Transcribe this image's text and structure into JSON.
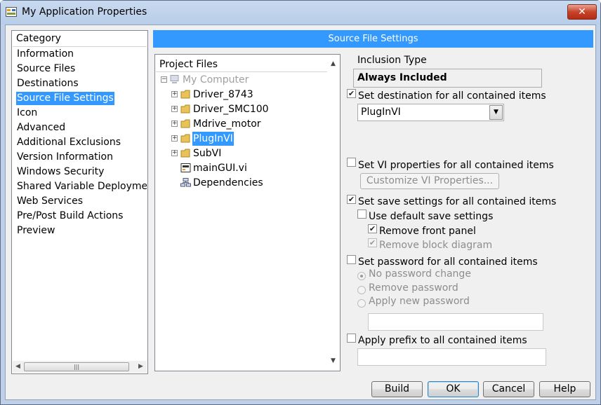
{
  "window": {
    "title": "My Application Properties",
    "close_label": "✕"
  },
  "category": {
    "header": "Category",
    "items": [
      "Information",
      "Source Files",
      "Destinations",
      "Source File Settings",
      "Icon",
      "Advanced",
      "Additional Exclusions",
      "Version Information",
      "Windows Security",
      "Shared Variable Deploymen",
      "Web Services",
      "Pre/Post Build Actions",
      "Preview"
    ],
    "selected": "Source File Settings"
  },
  "section_title": "Source File Settings",
  "project_files": {
    "header": "Project Files",
    "root": "My Computer",
    "items": [
      {
        "label": "Driver_8743",
        "icon": "folder-icon"
      },
      {
        "label": "Driver_SMC100",
        "icon": "folder-icon"
      },
      {
        "label": "Mdrive_motor",
        "icon": "folder-icon"
      },
      {
        "label": "PlugInVI",
        "icon": "folder-icon"
      },
      {
        "label": "SubVI",
        "icon": "folder-icon"
      },
      {
        "label": "mainGUI.vi",
        "icon": "vi-file-icon"
      },
      {
        "label": "Dependencies",
        "icon": "dependencies-icon"
      }
    ],
    "selected": "PlugInVI"
  },
  "settings": {
    "inclusion_type_label": "Inclusion Type",
    "inclusion_type_value": "Always Included",
    "set_destination_label": "Set destination for all contained items",
    "set_destination_checked": true,
    "destination_value": "PlugInVI",
    "set_vi_props_label": "Set VI properties for all contained items",
    "set_vi_props_checked": false,
    "customize_button": "Customize VI Properties...",
    "set_save_label": "Set save settings for all contained items",
    "set_save_checked": true,
    "use_default_save_label": "Use default save settings",
    "use_default_save_checked": false,
    "remove_front_panel_label": "Remove front panel",
    "remove_front_panel_checked": true,
    "remove_block_diagram_label": "Remove block diagram",
    "remove_block_diagram_checked": true,
    "set_password_label": "Set password for all contained items",
    "set_password_checked": false,
    "password_options": [
      "No password change",
      "Remove password",
      "Apply new password"
    ],
    "password_selected": "No password change",
    "apply_prefix_label": "Apply prefix to all contained items",
    "apply_prefix_checked": false
  },
  "buttons": {
    "build": "Build",
    "ok": "OK",
    "cancel": "Cancel",
    "help": "Help"
  }
}
